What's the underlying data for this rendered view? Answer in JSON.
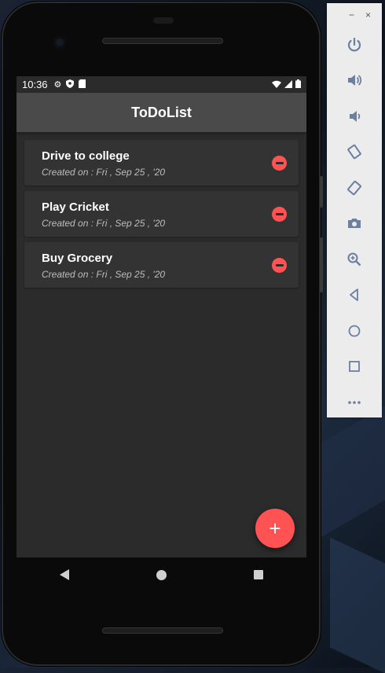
{
  "status_bar": {
    "time": "10:36",
    "left_icons": [
      "settings-icon",
      "shield-icon",
      "sd-card-icon"
    ],
    "right_icons": [
      "wifi-icon",
      "signal-icon",
      "battery-icon"
    ]
  },
  "app_bar": {
    "title": "ToDoList"
  },
  "todos": [
    {
      "title": "Drive to college",
      "created": "Created on : Fri , Sep 25 , '20"
    },
    {
      "title": "Play Cricket",
      "created": "Created on : Fri , Sep 25 , '20"
    },
    {
      "title": "Buy Grocery",
      "created": "Created on : Fri , Sep 25 , '20"
    }
  ],
  "fab": {
    "label": "+"
  },
  "emulator_toolbar": {
    "minimize": "−",
    "close": "×",
    "buttons": [
      "power-icon",
      "volume-up-icon",
      "volume-down-icon",
      "rotate-left-icon",
      "rotate-right-icon",
      "camera-icon",
      "zoom-icon",
      "back-icon",
      "home-icon",
      "overview-icon",
      "more-icon"
    ]
  },
  "colors": {
    "accent": "#ff5252",
    "app_bar": "#4a4a4a",
    "background": "#2b2b2b",
    "card": "#333333"
  }
}
